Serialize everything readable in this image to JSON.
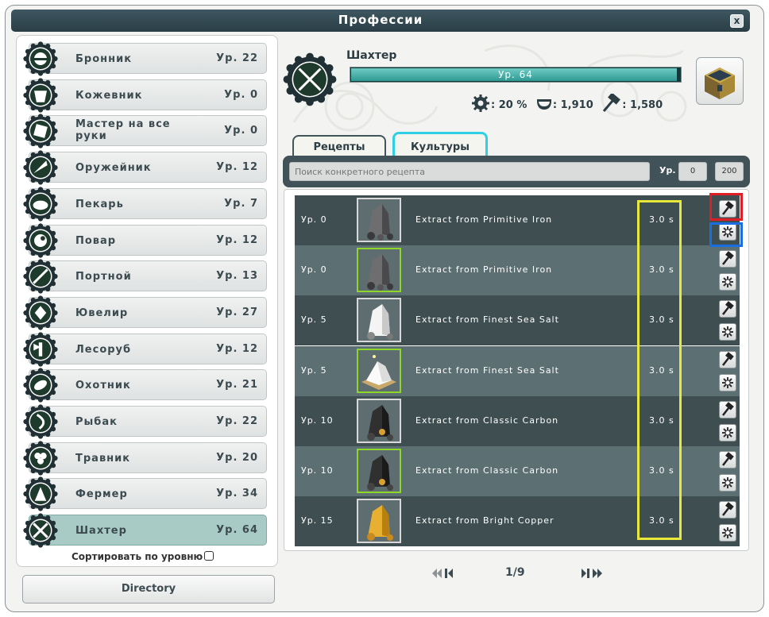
{
  "window": {
    "title": "Профессии",
    "close_label": "x"
  },
  "professions": [
    {
      "name": "Бронник",
      "level": "Ур. 22"
    },
    {
      "name": "Кожевник",
      "level": "Ур. 0"
    },
    {
      "name": "Мастер на все руки",
      "level": "Ур. 0"
    },
    {
      "name": "Оружейник",
      "level": "Ур. 12"
    },
    {
      "name": "Пекарь",
      "level": "Ур. 7"
    },
    {
      "name": "Повар",
      "level": "Ур. 12"
    },
    {
      "name": "Портной",
      "level": "Ур. 13"
    },
    {
      "name": "Ювелир",
      "level": "Ур. 27"
    },
    {
      "name": "Лесоруб",
      "level": "Ур. 12"
    },
    {
      "name": "Охотник",
      "level": "Ур. 21"
    },
    {
      "name": "Рыбак",
      "level": "Ур. 22"
    },
    {
      "name": "Травник",
      "level": "Ур. 20"
    },
    {
      "name": "Фермер",
      "level": "Ур. 34"
    },
    {
      "name": "Шахтер",
      "level": "Ур. 64"
    }
  ],
  "sort_label": "Сортировать по уровню",
  "directory_label": "Directory",
  "selected": {
    "title": "Шахтер",
    "xp_label": "Ур. 64",
    "xp_progress": 0.99,
    "stat_bonus": ": 20 %",
    "stat_kama": ": 1,910",
    "stat_hammer": ": 1,580"
  },
  "tabs": {
    "recipes": "Рецепты",
    "cultures": "Культуры"
  },
  "search": {
    "placeholder": "Поиск конкретного рецепта",
    "lvl_label": "Ур.",
    "lvl_min": "0",
    "lvl_max": "200"
  },
  "recipes": [
    {
      "level": "Ур. 0",
      "name": "Extract from Primitive Iron",
      "time": "3.0 s",
      "item": "iron-ore"
    },
    {
      "level": "Ур. 0",
      "name": "Extract from Primitive Iron",
      "time": "3.0 s",
      "item": "iron-ore"
    },
    {
      "level": "Ур. 5",
      "name": "Extract from Finest Sea Salt",
      "time": "3.0 s",
      "item": "salt"
    },
    {
      "level": "Ур. 5",
      "name": "Extract from Finest Sea Salt",
      "time": "3.0 s",
      "item": "salt-pile"
    },
    {
      "level": "Ур. 10",
      "name": "Extract from Classic Carbon",
      "time": "3.0 s",
      "item": "carbon"
    },
    {
      "level": "Ур. 10",
      "name": "Extract from Classic Carbon",
      "time": "3.0 s",
      "item": "carbon"
    },
    {
      "level": "Ур. 15",
      "name": "Extract from Bright Copper",
      "time": "3.0 s",
      "item": "copper"
    }
  ],
  "pager": {
    "page": "1/9"
  },
  "colors": {
    "accent": "#2fd0e6",
    "highlight_red": "#e01d24",
    "highlight_blue": "#1b6ee0",
    "highlight_yellow": "#e8e83a",
    "xp_fill": "#2f9a92"
  }
}
